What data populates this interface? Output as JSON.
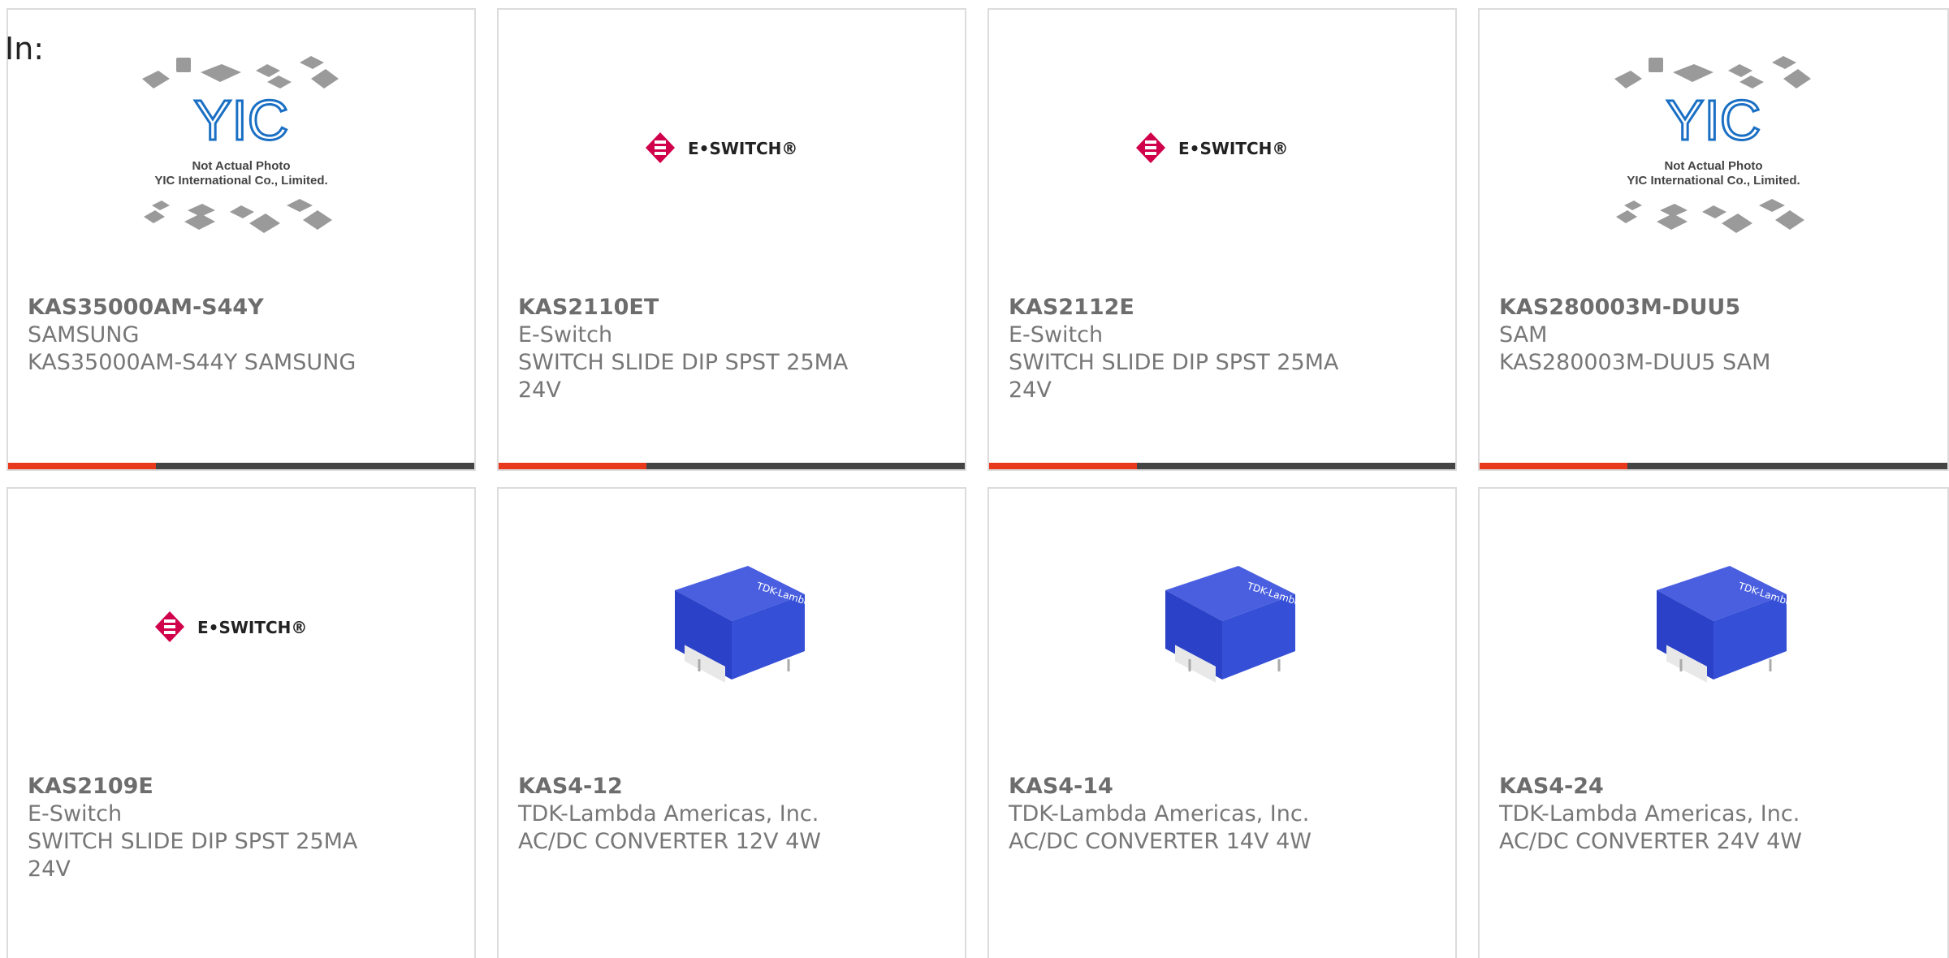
{
  "filter_label": "In:",
  "colors": {
    "accent": "#e8391c",
    "bar": "#444444",
    "border": "#dcdcdc",
    "eswitch_red": "#d0004a",
    "tdk_blue": "#2a41c8"
  },
  "products": [
    {
      "part_number": "KAS35000AM-S44Y",
      "manufacturer": "SAMSUNG",
      "description": "KAS35000AM-S44Y SAMSUNG",
      "image": "yic-placeholder",
      "image_text_1": "Not Actual Photo",
      "image_text_2": "YIC International Co., Limited.",
      "image_logo": "YIC"
    },
    {
      "part_number": "KAS2110ET",
      "manufacturer": "E-Switch",
      "description": "SWITCH SLIDE DIP SPST 25MA 24V",
      "image": "eswitch-logo",
      "image_logo": "E•SWITCH®"
    },
    {
      "part_number": "KAS2112E",
      "manufacturer": "E-Switch",
      "description": "SWITCH SLIDE DIP SPST 25MA 24V",
      "image": "eswitch-logo",
      "image_logo": "E•SWITCH®"
    },
    {
      "part_number": "KAS280003M-DUU5",
      "manufacturer": "SAM",
      "description": "KAS280003M-DUU5 SAM",
      "image": "yic-placeholder",
      "image_text_1": "Not Actual Photo",
      "image_text_2": "YIC International Co., Limited.",
      "image_logo": "YIC"
    },
    {
      "part_number": "KAS2109E",
      "manufacturer": "E-Switch",
      "description": "SWITCH SLIDE DIP SPST 25MA 24V",
      "image": "eswitch-logo",
      "image_logo": "E•SWITCH®"
    },
    {
      "part_number": "KAS4-12",
      "manufacturer": "TDK-Lambda Americas, Inc.",
      "description": "AC/DC CONVERTER 12V 4W",
      "image": "tdk-module",
      "image_logo": "TDK-Lambda"
    },
    {
      "part_number": "KAS4-14",
      "manufacturer": "TDK-Lambda Americas, Inc.",
      "description": "AC/DC CONVERTER 14V 4W",
      "image": "tdk-module",
      "image_logo": "TDK-Lambda"
    },
    {
      "part_number": "KAS4-24",
      "manufacturer": "TDK-Lambda Americas, Inc.",
      "description": "AC/DC CONVERTER 24V 4W",
      "image": "tdk-module",
      "image_logo": "TDK-Lambda"
    }
  ]
}
